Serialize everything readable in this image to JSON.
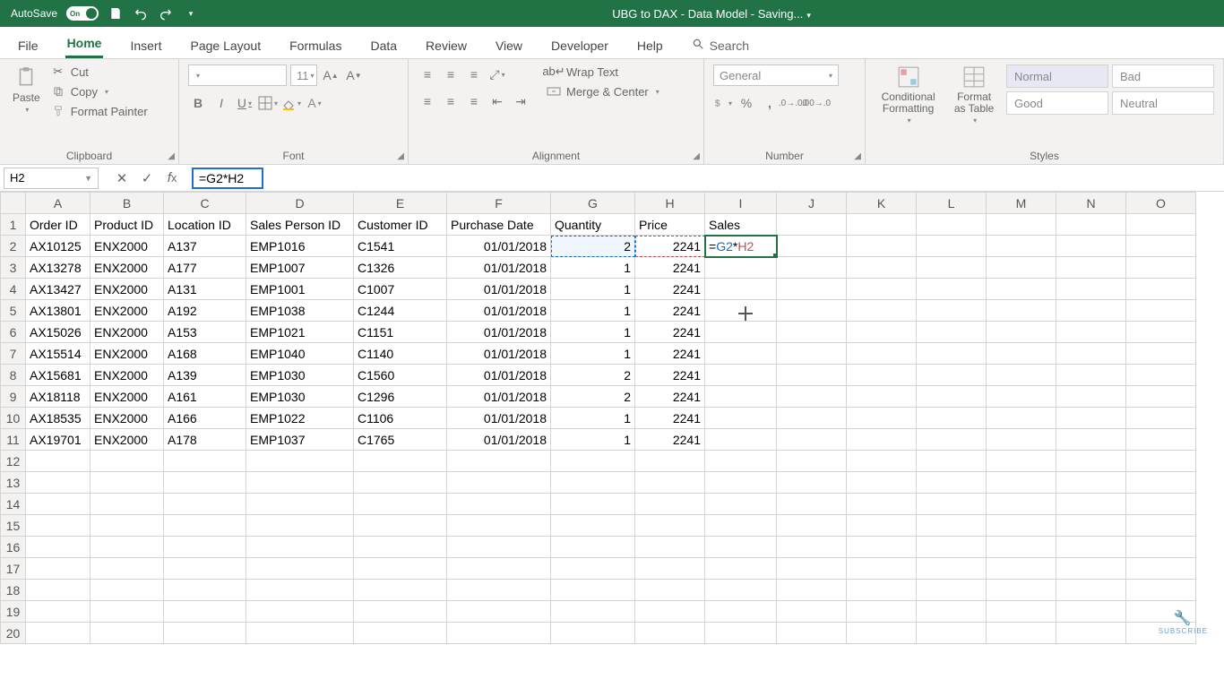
{
  "title_bar": {
    "autosave_label": "AutoSave",
    "autosave_state": "On",
    "document_title": "UBG to DAX - Data Model - Saving..."
  },
  "tabs": {
    "file": "File",
    "home": "Home",
    "insert": "Insert",
    "page_layout": "Page Layout",
    "formulas": "Formulas",
    "data": "Data",
    "review": "Review",
    "view": "View",
    "developer": "Developer",
    "help": "Help",
    "search": "Search"
  },
  "ribbon": {
    "clipboard": {
      "label": "Clipboard",
      "paste": "Paste",
      "cut": "Cut",
      "copy": "Copy",
      "format_painter": "Format Painter"
    },
    "font": {
      "label": "Font",
      "size": "11"
    },
    "alignment": {
      "label": "Alignment",
      "wrap": "Wrap Text",
      "merge": "Merge & Center"
    },
    "number": {
      "label": "Number",
      "format": "General"
    },
    "styles": {
      "label": "Styles",
      "cond": "Conditional Formatting",
      "table": "Format as Table",
      "normal": "Normal",
      "bad": "Bad",
      "good": "Good",
      "neutral": "Neutral"
    }
  },
  "formula_bar": {
    "name_box": "H2",
    "formula": "=G2*H2"
  },
  "columns": [
    "A",
    "B",
    "C",
    "D",
    "E",
    "F",
    "G",
    "H",
    "I",
    "J",
    "K",
    "L",
    "M",
    "N",
    "O"
  ],
  "headers": {
    "A": "Order ID",
    "B": "Product ID",
    "C": "Location ID",
    "D": "Sales Person ID",
    "E": "Customer ID",
    "F": "Purchase Date",
    "G": "Quantity",
    "H": "Price",
    "I": "Sales"
  },
  "rows": [
    {
      "A": "AX10125",
      "B": "ENX2000",
      "C": "A137",
      "D": "EMP1016",
      "E": "C1541",
      "F": "01/01/2018",
      "G": "2",
      "H": "2241"
    },
    {
      "A": "AX13278",
      "B": "ENX2000",
      "C": "A177",
      "D": "EMP1007",
      "E": "C1326",
      "F": "01/01/2018",
      "G": "1",
      "H": "2241"
    },
    {
      "A": "AX13427",
      "B": "ENX2000",
      "C": "A131",
      "D": "EMP1001",
      "E": "C1007",
      "F": "01/01/2018",
      "G": "1",
      "H": "2241"
    },
    {
      "A": "AX13801",
      "B": "ENX2000",
      "C": "A192",
      "D": "EMP1038",
      "E": "C1244",
      "F": "01/01/2018",
      "G": "1",
      "H": "2241"
    },
    {
      "A": "AX15026",
      "B": "ENX2000",
      "C": "A153",
      "D": "EMP1021",
      "E": "C1151",
      "F": "01/01/2018",
      "G": "1",
      "H": "2241"
    },
    {
      "A": "AX15514",
      "B": "ENX2000",
      "C": "A168",
      "D": "EMP1040",
      "E": "C1140",
      "F": "01/01/2018",
      "G": "1",
      "H": "2241"
    },
    {
      "A": "AX15681",
      "B": "ENX2000",
      "C": "A139",
      "D": "EMP1030",
      "E": "C1560",
      "F": "01/01/2018",
      "G": "2",
      "H": "2241"
    },
    {
      "A": "AX18118",
      "B": "ENX2000",
      "C": "A161",
      "D": "EMP1030",
      "E": "C1296",
      "F": "01/01/2018",
      "G": "2",
      "H": "2241"
    },
    {
      "A": "AX18535",
      "B": "ENX2000",
      "C": "A166",
      "D": "EMP1022",
      "E": "C1106",
      "F": "01/01/2018",
      "G": "1",
      "H": "2241"
    },
    {
      "A": "AX19701",
      "B": "ENX2000",
      "C": "A178",
      "D": "EMP1037",
      "E": "C1765",
      "F": "01/01/2018",
      "G": "1",
      "H": "2241"
    }
  ],
  "active_cell": {
    "row": 2,
    "col": "I",
    "display_eq": "=",
    "display_g2": "G2",
    "display_star": "*",
    "display_h2": "H2"
  },
  "empty_row_count": 9
}
